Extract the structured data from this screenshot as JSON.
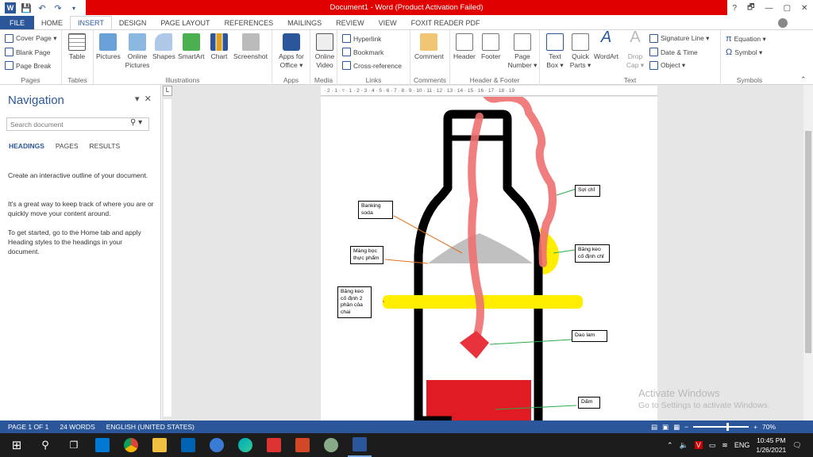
{
  "window": {
    "title": "Document1 - Word (Product Activation Failed)",
    "controls": {
      "help": "?",
      "restore": "🗗",
      "minimize": "—",
      "maximize": "▢",
      "close": "✕"
    }
  },
  "quick_access": {
    "icons": [
      "word-app-icon",
      "save-icon",
      "undo-icon",
      "redo-icon",
      "customize-icon"
    ]
  },
  "tabs": [
    "FILE",
    "HOME",
    "INSERT",
    "DESIGN",
    "PAGE LAYOUT",
    "REFERENCES",
    "MAILINGS",
    "REVIEW",
    "VIEW",
    "FOXIT READER PDF"
  ],
  "active_tab": "INSERT",
  "ribbon": {
    "pages": {
      "label": "Pages",
      "items": [
        "Cover Page ▾",
        "Blank Page",
        "Page Break"
      ]
    },
    "tables": {
      "label": "Tables",
      "table": "Table"
    },
    "illustrations": {
      "label": "Illustrations",
      "items": [
        "Pictures",
        "Online Pictures",
        "Shapes",
        "SmartArt",
        "Chart",
        "Screenshot"
      ]
    },
    "apps": {
      "label": "Apps",
      "item": "Apps for Office ▾"
    },
    "media": {
      "label": "Media",
      "item": "Online Video"
    },
    "links": {
      "label": "Links",
      "items": [
        "Hyperlink",
        "Bookmark",
        "Cross-reference"
      ]
    },
    "comments": {
      "label": "Comments",
      "item": "Comment"
    },
    "header_footer": {
      "label": "Header & Footer",
      "items": [
        "Header",
        "Footer",
        "Page Number ▾"
      ]
    },
    "text": {
      "label": "Text",
      "items": [
        "Text Box ▾",
        "Quick Parts ▾",
        "WordArt",
        "Drop Cap ▾"
      ],
      "small": [
        "Signature Line ▾",
        "Date & Time",
        "Object ▾"
      ]
    },
    "symbols": {
      "label": "Symbols",
      "items": [
        "Equation ▾",
        "Symbol ▾"
      ]
    }
  },
  "navigation": {
    "title": "Navigation",
    "search_placeholder": "Search document",
    "tabs": [
      "HEADINGS",
      "PAGES",
      "RESULTS"
    ],
    "paragraphs": [
      "Create an interactive outline of your document.",
      "It's a great way to keep track of where you are or quickly move your content around.",
      "To get started, go to the Home tab and apply Heading styles to the headings in your document."
    ]
  },
  "ruler": {
    "marks": "· 2 · 1 · ▿ · 1 · 2 · 3 · 4 · 5 · 6 · 7 · 8 · 9 · 10 · 11 · 12 · 13 · 14 · 15 · 16 · 17 · 18 · 19",
    "corner": "L"
  },
  "callouts": {
    "soda": "Banking soda",
    "wrap": "Màng bọc thực phẩm",
    "tape2": "Băng keo cố định 2 phần của chai",
    "thread": "Sợi chỉ",
    "tape1": "Băng keo cố định chỉ",
    "blade": "Dao lam",
    "vinegar": "Dấm"
  },
  "watermark": {
    "line1": "Activate Windows",
    "line2": "Go to Settings to activate Windows."
  },
  "status": {
    "page": "PAGE 1 OF 1",
    "words": "24 WORDS",
    "lang": "ENGLISH (UNITED STATES)",
    "zoom": "70%"
  },
  "taskbar": {
    "apps": [
      "start-icon",
      "search-icon",
      "task-view-icon",
      "mail-icon",
      "chrome-icon",
      "file-explorer-icon",
      "store-icon",
      "cortana-icon",
      "edge-icon",
      "photos-icon",
      "powerpoint-icon",
      "paint-icon",
      "word-icon"
    ],
    "lang": "ENG",
    "time": "10:45 PM",
    "date": "1/26/2021"
  },
  "colors": {
    "word_blue": "#2b579a",
    "title_red": "#e00000",
    "bottle": "#000000",
    "thread": "#f07070",
    "tape": "#ffee00",
    "vinegar": "#e01b24",
    "soda": "#c0c0c0",
    "arrow": "#2eaa4a"
  }
}
